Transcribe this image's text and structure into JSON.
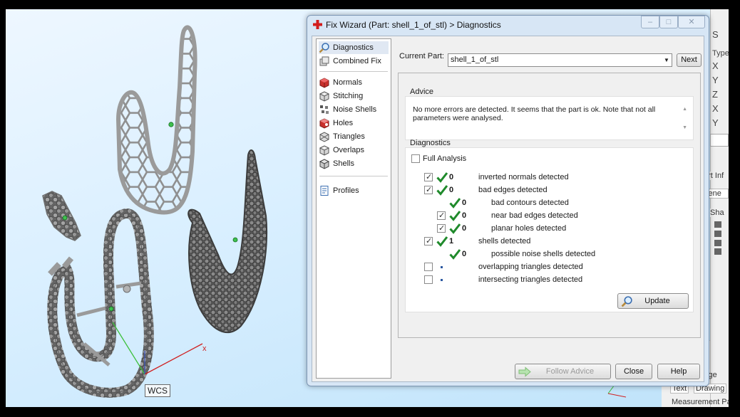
{
  "dialog": {
    "title": "Fix Wizard (Part: shell_1_of_stl) > Diagnostics",
    "current_part_label": "Current Part:",
    "current_part_value": "shell_1_of_stl",
    "next_label": "Next",
    "advice_label": "Advice",
    "advice_text": "No more errors are detected. It seems that the part is ok. Note that not all parameters were analysed.",
    "diagnostics_label": "Diagnostics",
    "full_analysis_label": "Full Analysis",
    "update_label": "Update",
    "follow_advice_label": "Follow Advice",
    "close_label": "Close",
    "help_label": "Help"
  },
  "nav": [
    {
      "label": "Diagnostics",
      "icon": "magnifier-icon"
    },
    {
      "label": "Combined Fix",
      "icon": "combined-fix-icon"
    },
    {
      "label": "Normals",
      "icon": "normals-cube-icon"
    },
    {
      "label": "Stitching",
      "icon": "stitching-cube-icon"
    },
    {
      "label": "Noise Shells",
      "icon": "noise-shells-icon"
    },
    {
      "label": "Holes",
      "icon": "holes-cube-icon"
    },
    {
      "label": "Triangles",
      "icon": "triangles-cube-icon"
    },
    {
      "label": "Overlaps",
      "icon": "overlaps-cube-icon"
    },
    {
      "label": "Shells",
      "icon": "shells-cube-icon"
    },
    {
      "label": "Profiles",
      "icon": "profiles-doc-icon"
    }
  ],
  "diagnostics": [
    {
      "checkbox": true,
      "checked": true,
      "status": "check",
      "count": "0",
      "label": "inverted normals detected",
      "indent": 0
    },
    {
      "checkbox": true,
      "checked": true,
      "status": "check",
      "count": "0",
      "label": "bad edges detected",
      "indent": 0
    },
    {
      "checkbox": false,
      "checked": false,
      "status": "check",
      "count": "0",
      "label": "bad contours detected",
      "indent": 1
    },
    {
      "checkbox": true,
      "checked": true,
      "status": "check",
      "count": "0",
      "label": "near bad edges detected",
      "indent": 1
    },
    {
      "checkbox": true,
      "checked": true,
      "status": "check",
      "count": "0",
      "label": "planar holes detected",
      "indent": 1
    },
    {
      "checkbox": true,
      "checked": true,
      "status": "check",
      "count": "1",
      "label": "shells detected",
      "indent": 0
    },
    {
      "checkbox": false,
      "checked": false,
      "status": "check",
      "count": "0",
      "label": "possible noise shells detected",
      "indent": 1
    },
    {
      "checkbox": true,
      "checked": false,
      "status": "dot",
      "count": "",
      "label": "overlapping triangles detected",
      "indent": 0
    },
    {
      "checkbox": true,
      "checked": false,
      "status": "dot",
      "count": "",
      "label": "intersecting triangles detected",
      "indent": 0
    }
  ],
  "viewport": {
    "wcs_label": "WCS",
    "axis_x_label": "x"
  },
  "right_panel": {
    "tab_s": "S",
    "type_label": "Type",
    "axes": [
      "X",
      "Y",
      "Z",
      "X",
      "Y"
    ],
    "part_info": "art Inf",
    "scene": "cene",
    "sha": "Sha",
    "page": "Page",
    "text": "Text",
    "drawing": "Drawing",
    "measurement": "Measurement Pa"
  },
  "colors": {
    "check_green": "#1f8a2b",
    "dialog_frame": "#d7e6f5",
    "viewport_bg": "#d9efff"
  }
}
